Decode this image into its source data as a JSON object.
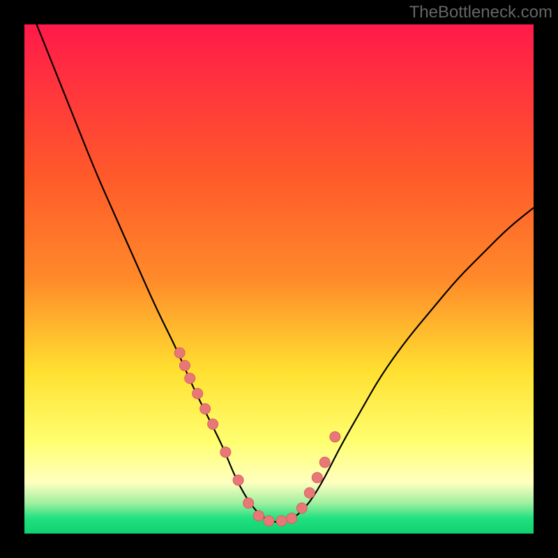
{
  "watermark": "TheBottleneck.com",
  "colors": {
    "gradient_top": "#ff1a4a",
    "gradient_mid_upper": "#ff8a2a",
    "gradient_mid": "#ffe030",
    "gradient_mid_lower": "#ffff70",
    "gradient_lower": "#ffffc0",
    "gradient_green_light": "#a0f0a0",
    "gradient_green": "#20e080",
    "curve": "#000000",
    "marker_fill": "#e87878",
    "marker_stroke": "#d86060"
  },
  "chart_data": {
    "type": "line",
    "title": "",
    "xlabel": "",
    "ylabel": "",
    "xlim": [
      0,
      100
    ],
    "ylim": [
      0,
      100
    ],
    "series": [
      {
        "name": "curve",
        "x": [
          2,
          6,
          10,
          14,
          18,
          22,
          26,
          30,
          33,
          36,
          39,
          41,
          43,
          45,
          47,
          50,
          53,
          56,
          59,
          62,
          66,
          70,
          75,
          80,
          85,
          90,
          95,
          100
        ],
        "y": [
          101,
          91,
          81,
          71,
          62,
          53,
          44,
          36,
          29,
          23,
          17,
          12,
          8,
          5,
          3,
          2,
          3,
          6,
          11,
          17,
          24,
          31,
          38,
          44,
          50,
          55,
          60,
          64
        ]
      }
    ],
    "markers": {
      "name": "data-points",
      "x": [
        30.5,
        31.5,
        32.5,
        34,
        35.5,
        37,
        39.5,
        42,
        44,
        46,
        48,
        50.5,
        52.5,
        54.5,
        56,
        57.5,
        59,
        61
      ],
      "y": [
        35.5,
        33,
        30.5,
        27.5,
        24.5,
        21.5,
        16,
        10.5,
        6,
        3.5,
        2.5,
        2.5,
        3,
        5,
        8,
        11,
        14,
        19
      ]
    }
  }
}
